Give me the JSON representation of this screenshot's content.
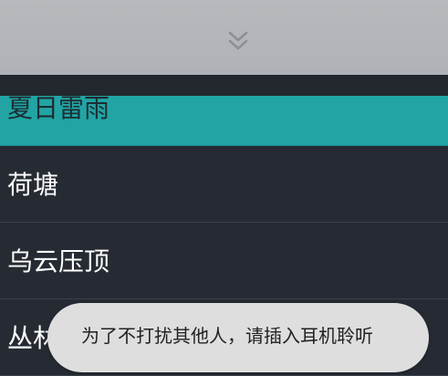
{
  "header": {
    "collapse_icon": "double-chevron-down-icon"
  },
  "playlist": {
    "items": [
      {
        "label": "夏日雷雨",
        "active": true
      },
      {
        "label": "荷塘",
        "active": false
      },
      {
        "label": "乌云压顶",
        "active": false
      },
      {
        "label": "丛林",
        "active": false
      }
    ]
  },
  "toast": {
    "message": "为了不打扰其他人，请插入耳机聆听"
  },
  "colors": {
    "accent": "#22a4a5",
    "background": "#262b33",
    "header": "#b3b5b9",
    "toast": "#dedede"
  }
}
